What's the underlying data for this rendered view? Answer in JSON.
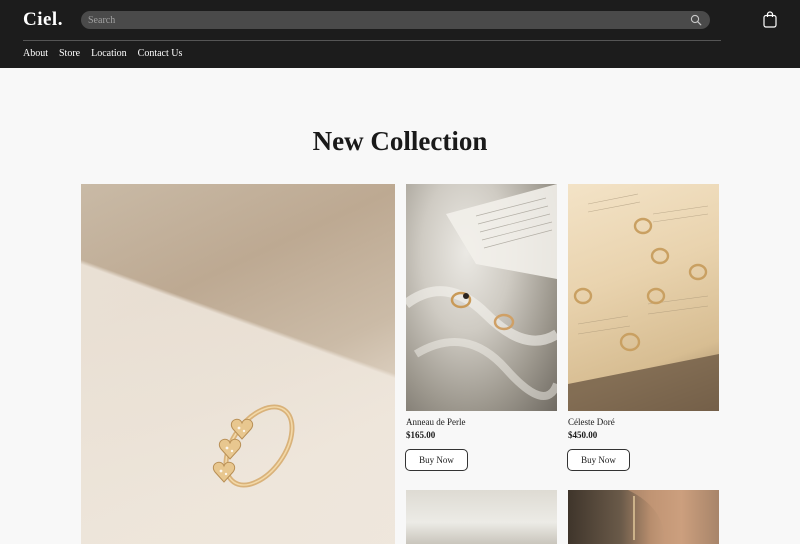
{
  "header": {
    "logo": "Ciel.",
    "search_placeholder": "Search",
    "nav": [
      "About",
      "Store",
      "Location",
      "Contact Us"
    ]
  },
  "main": {
    "title": "New Collection",
    "products": [
      {
        "name": "Anneau de Perle",
        "price": "$165.00",
        "button": "Buy Now"
      },
      {
        "name": "Céleste Doré",
        "price": "$450.00",
        "button": "Buy Now"
      }
    ]
  },
  "colors": {
    "header_bg": "#1c1c1c",
    "page_bg": "#f8f8f8",
    "search_bg": "#4a4a4a"
  },
  "icons": [
    "search-icon",
    "shopping-bag-icon"
  ]
}
